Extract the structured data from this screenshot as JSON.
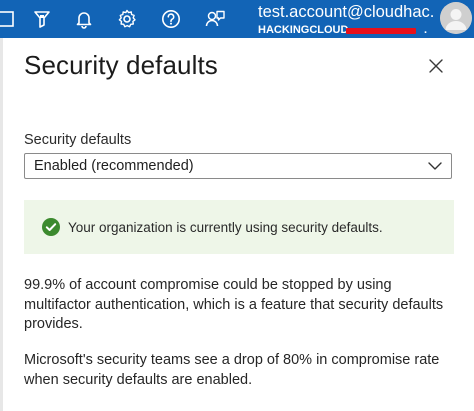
{
  "header": {
    "icons": [
      "terminal-icon",
      "directory-filter-icon",
      "notifications-icon",
      "settings-icon",
      "help-icon",
      "feedback-icon"
    ],
    "account_email": "test.account@cloudhac...",
    "account_tenant": "HACKINGCLOUD",
    "tenant_suffix": "."
  },
  "panel": {
    "title": "Security defaults",
    "field_label": "Security defaults",
    "dropdown_value": "Enabled (recommended)",
    "banner_text": "Your organization is currently using security defaults.",
    "paragraph_1": "99.9% of account compromise could be stopped by using multifactor authentication, which is a feature that security defaults provides.",
    "paragraph_2": "Microsoft's security teams see a drop of 80% in compromise rate when security defaults are enabled."
  },
  "colors": {
    "header_bg": "#1264b6",
    "success_green": "#3c8a2e",
    "banner_bg": "#eef6e8",
    "redaction": "#e8101a"
  }
}
